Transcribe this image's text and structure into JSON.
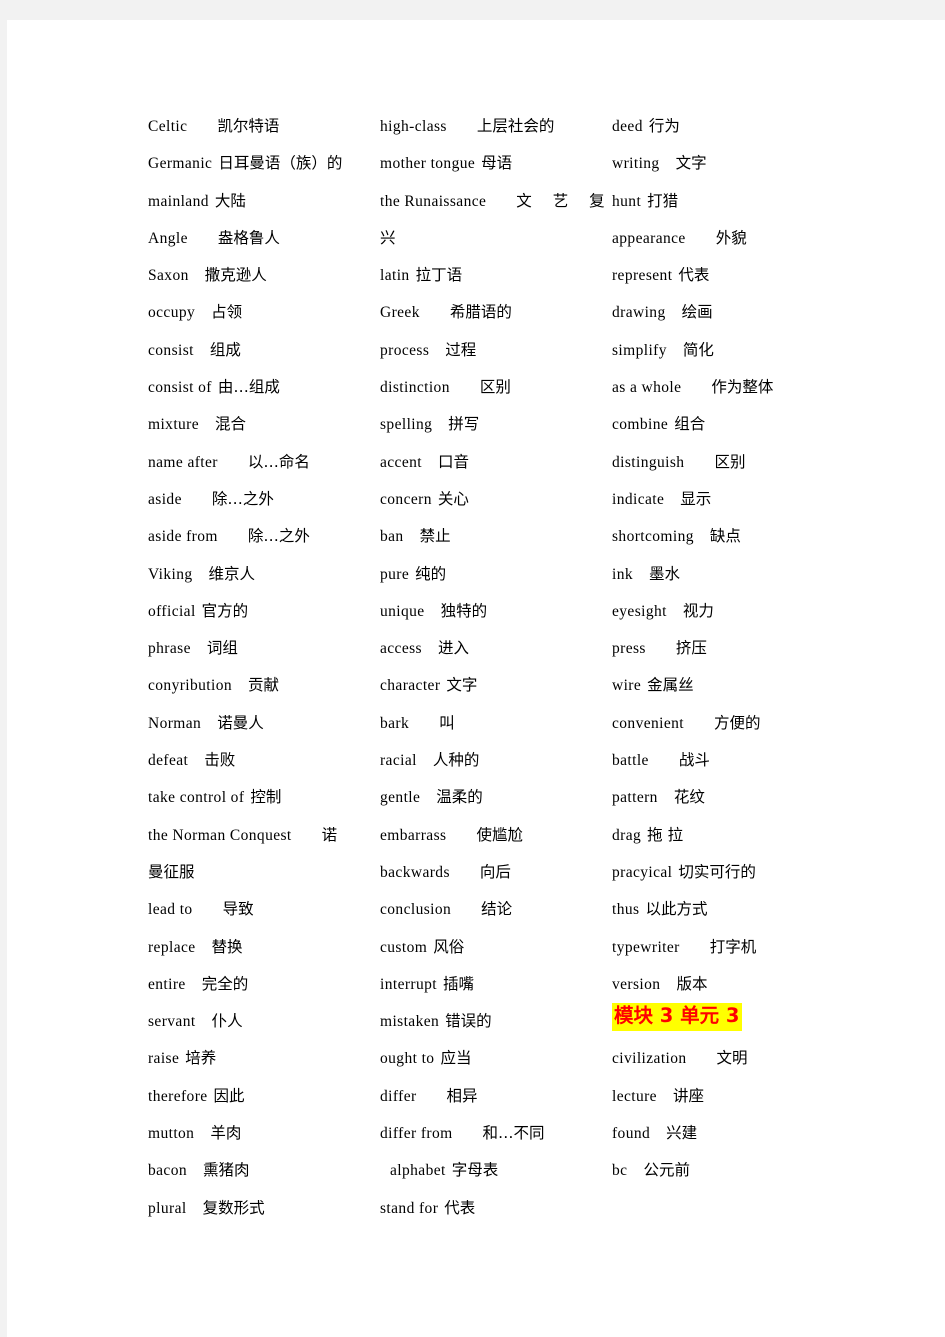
{
  "document": {
    "title": "English Vocabulary List",
    "text_color": "#000000",
    "page_background": "#ffffff",
    "canvas_background": "#f2f2f2",
    "highlight_background": "#ffff00",
    "highlight_text_color": "#ff0000"
  },
  "columns": [
    {
      "id": "column-1",
      "entries": [
        {
          "term": "Celtic",
          "gap": "lg",
          "meaning": "凯尔特语"
        },
        {
          "term": "Germanic",
          "gap": "sm",
          "meaning": "日耳曼语（族）的"
        },
        {
          "term": "mainland",
          "gap": "sm",
          "meaning": "大陆"
        },
        {
          "term": "Angle",
          "gap": "lg",
          "meaning": "盎格鲁人"
        },
        {
          "term": "Saxon",
          "gap": "md",
          "meaning": "撒克逊人"
        },
        {
          "term": "occupy",
          "gap": "md",
          "meaning": "占领"
        },
        {
          "term": "consist",
          "gap": "md",
          "meaning": "组成"
        },
        {
          "term": "consist of",
          "gap": "sm",
          "meaning": "由…组成"
        },
        {
          "term": "mixture",
          "gap": "md",
          "meaning": "混合"
        },
        {
          "term": "name after",
          "gap": "lg",
          "meaning": "以…命名"
        },
        {
          "term": "aside",
          "gap": "lg",
          "meaning": "除…之外"
        },
        {
          "term": "aside from",
          "gap": "lg",
          "meaning": "除…之外"
        },
        {
          "term": "Viking",
          "gap": "md",
          "meaning": "维京人"
        },
        {
          "term": "official",
          "gap": "sm",
          "meaning": "官方的"
        },
        {
          "term": "phrase",
          "gap": "md",
          "meaning": "词组"
        },
        {
          "term": "conyribution",
          "gap": "md",
          "meaning": "贡献"
        },
        {
          "term": "Norman",
          "gap": "md",
          "meaning": "诺曼人"
        },
        {
          "term": "defeat",
          "gap": "md",
          "meaning": "击败"
        },
        {
          "term": "take control of",
          "gap": "sm",
          "meaning": "控制"
        },
        {
          "term": "the Norman Conquest",
          "gap": "lg",
          "meaning": "诺"
        },
        {
          "term": "",
          "gap": "none",
          "meaning": "曼征服"
        },
        {
          "term": "lead to",
          "gap": "lg",
          "meaning": "导致"
        },
        {
          "term": "replace",
          "gap": "md",
          "meaning": "替换"
        },
        {
          "term": "entire",
          "gap": "md",
          "meaning": "完全的"
        },
        {
          "term": "servant",
          "gap": "md",
          "meaning": "仆人"
        },
        {
          "term": "raise",
          "gap": "sm",
          "meaning": "培养"
        },
        {
          "term": "therefore",
          "gap": "sm",
          "meaning": "因此"
        },
        {
          "term": "mutton",
          "gap": "md",
          "meaning": "羊肉"
        },
        {
          "term": "bacon",
          "gap": "md",
          "meaning": "熏猪肉"
        },
        {
          "term": "plural",
          "gap": "md",
          "meaning": "复数形式"
        }
      ]
    },
    {
      "id": "column-2",
      "entries": [
        {
          "term": "high-class",
          "gap": "lg",
          "meaning": "上层社会的"
        },
        {
          "term": "mother tongue",
          "gap": "sm",
          "meaning": "母语"
        },
        {
          "term": "the Runaissance",
          "gap": "lg",
          "meaning": "文 艺 复",
          "spread": true
        },
        {
          "term": "",
          "gap": "none",
          "meaning": "兴"
        },
        {
          "term": "latin",
          "gap": "sm",
          "meaning": "拉丁语"
        },
        {
          "term": "Greek",
          "gap": "lg",
          "meaning": "希腊语的"
        },
        {
          "term": "process",
          "gap": "md",
          "meaning": "过程"
        },
        {
          "term": "distinction",
          "gap": "lg",
          "meaning": "区别"
        },
        {
          "term": "spelling",
          "gap": "md",
          "meaning": "拼写"
        },
        {
          "term": "accent",
          "gap": "md",
          "meaning": "口音"
        },
        {
          "term": "concern",
          "gap": "sm",
          "meaning": "关心"
        },
        {
          "term": "ban",
          "gap": "md",
          "meaning": "禁止"
        },
        {
          "term": "pure",
          "gap": "sm",
          "meaning": "纯的"
        },
        {
          "term": "unique",
          "gap": "md",
          "meaning": "独特的"
        },
        {
          "term": "access",
          "gap": "md",
          "meaning": "进入"
        },
        {
          "term": "character",
          "gap": "sm",
          "meaning": "文字"
        },
        {
          "term": "bark",
          "gap": "lg",
          "meaning": "叫"
        },
        {
          "term": "racial",
          "gap": "md",
          "meaning": "人种的"
        },
        {
          "term": "gentle",
          "gap": "md",
          "meaning": "温柔的"
        },
        {
          "term": "embarrass",
          "gap": "lg",
          "meaning": "使尴尬"
        },
        {
          "term": "backwards",
          "gap": "lg",
          "meaning": "向后"
        },
        {
          "term": "conclusion",
          "gap": "lg",
          "meaning": "结论"
        },
        {
          "term": "custom",
          "gap": "sm",
          "meaning": "风俗"
        },
        {
          "term": "interrupt",
          "gap": "sm",
          "meaning": "插嘴"
        },
        {
          "term": "mistaken",
          "gap": "sm",
          "meaning": "错误的"
        },
        {
          "term": "ought to",
          "gap": "sm",
          "meaning": "应当"
        },
        {
          "term": "differ",
          "gap": "lg",
          "meaning": "相异"
        },
        {
          "term": "differ from",
          "gap": "lg",
          "meaning": "和…不同"
        },
        {
          "term": "alphabet",
          "gap": "sm",
          "meaning": "字母表",
          "indent": true
        },
        {
          "term": "stand for",
          "gap": "sm",
          "meaning": "代表"
        }
      ]
    },
    {
      "id": "column-3",
      "entries": [
        {
          "term": "deed",
          "gap": "sm",
          "meaning": "行为"
        },
        {
          "term": "writing",
          "gap": "md",
          "meaning": "文字"
        },
        {
          "term": "hunt",
          "gap": "sm",
          "meaning": "打猎"
        },
        {
          "term": "appearance",
          "gap": "lg",
          "meaning": "外貌"
        },
        {
          "term": "represent",
          "gap": "sm",
          "meaning": "代表"
        },
        {
          "term": "drawing",
          "gap": "md",
          "meaning": "绘画"
        },
        {
          "term": "simplify",
          "gap": "md",
          "meaning": "简化"
        },
        {
          "term": "as a whole",
          "gap": "lg",
          "meaning": "作为整体"
        },
        {
          "term": "combine",
          "gap": "sm",
          "meaning": "组合"
        },
        {
          "term": "distinguish",
          "gap": "lg",
          "meaning": "区别"
        },
        {
          "term": "indicate",
          "gap": "md",
          "meaning": "显示"
        },
        {
          "term": "shortcoming",
          "gap": "md",
          "meaning": "缺点"
        },
        {
          "term": "ink",
          "gap": "md",
          "meaning": "墨水"
        },
        {
          "term": "eyesight",
          "gap": "md",
          "meaning": "视力"
        },
        {
          "term": "press",
          "gap": "lg",
          "meaning": "挤压"
        },
        {
          "term": "wire",
          "gap": "sm",
          "meaning": "金属丝"
        },
        {
          "term": "convenient",
          "gap": "lg",
          "meaning": "方便的"
        },
        {
          "term": "battle",
          "gap": "lg",
          "meaning": "战斗"
        },
        {
          "term": "pattern",
          "gap": "md",
          "meaning": "花纹"
        },
        {
          "term": "drag",
          "gap": "sm",
          "meaning": "拖 拉"
        },
        {
          "term": "pracyical",
          "gap": "sm",
          "meaning": "切实可行的"
        },
        {
          "term": "thus",
          "gap": "sm",
          "meaning": "以此方式"
        },
        {
          "term": "typewriter",
          "gap": "lg",
          "meaning": "打字机"
        },
        {
          "term": "version",
          "gap": "md",
          "meaning": "版本"
        },
        {
          "section": "模块 3 单元 3"
        },
        {
          "term": "civilization",
          "gap": "lg",
          "meaning": "文明"
        },
        {
          "term": "lecture",
          "gap": "md",
          "meaning": "讲座"
        },
        {
          "term": "found",
          "gap": "md",
          "meaning": "兴建"
        },
        {
          "term": "bc",
          "gap": "md",
          "meaning": "公元前"
        }
      ]
    }
  ]
}
